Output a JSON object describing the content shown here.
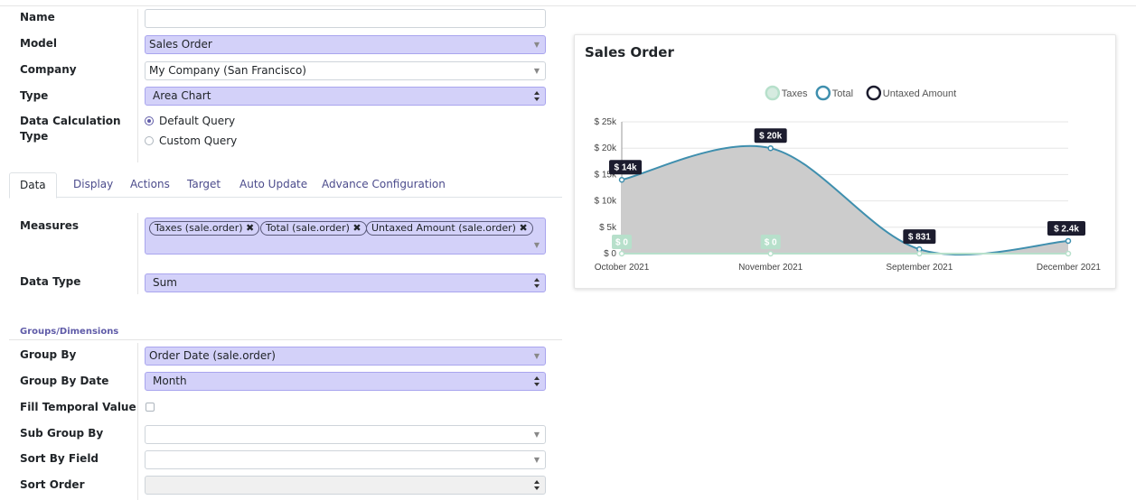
{
  "form": {
    "name": {
      "label": "Name",
      "value": ""
    },
    "model": {
      "label": "Model",
      "value": "Sales Order"
    },
    "company": {
      "label": "Company",
      "value": "My Company (San Francisco)"
    },
    "type": {
      "label": "Type",
      "value": "Area Chart"
    },
    "calc_type": {
      "label_line1": "Data Calculation",
      "label_line2": "Type",
      "options": [
        "Default Query",
        "Custom Query"
      ],
      "selected": "Default Query"
    }
  },
  "tabs": [
    {
      "label": "Data",
      "active": true
    },
    {
      "label": "Display",
      "active": false
    },
    {
      "label": "Actions",
      "active": false
    },
    {
      "label": "Target",
      "active": false
    },
    {
      "label": "Auto Update",
      "active": false
    },
    {
      "label": "Advance Configuration",
      "active": false
    }
  ],
  "data_tab": {
    "measures": {
      "label": "Measures",
      "tags": [
        "Taxes (sale.order)",
        "Total (sale.order)",
        "Untaxed Amount (sale.order)"
      ]
    },
    "data_type": {
      "label": "Data Type",
      "value": "Sum"
    }
  },
  "groups": {
    "section_title": "Groups/Dimensions",
    "group_by": {
      "label": "Group By",
      "value": "Order Date (sale.order)"
    },
    "group_by_date": {
      "label": "Group By Date",
      "value": "Month"
    },
    "fill_temporal": {
      "label": "Fill Temporal Value",
      "checked": false
    },
    "sub_group_by": {
      "label": "Sub Group By",
      "value": ""
    },
    "sort_by_field": {
      "label": "Sort By Field",
      "value": ""
    },
    "sort_order": {
      "label": "Sort Order",
      "value": ""
    }
  },
  "chart_data": {
    "type": "area",
    "title": "Sales Order",
    "categories": [
      "October 2021",
      "November 2021",
      "September 2021",
      "December 2021"
    ],
    "series": [
      {
        "name": "Taxes",
        "values": [
          0,
          0,
          0,
          0
        ],
        "color": "#b7e0cb",
        "labels": [
          "$ 0",
          "$ 0",
          "",
          ""
        ]
      },
      {
        "name": "Total",
        "values": [
          14000,
          20000,
          831,
          2400
        ],
        "color": "#3f8fae",
        "labels": [
          "$ 14k",
          "$ 20k",
          "$ 831",
          "$ 2.4k"
        ]
      },
      {
        "name": "Untaxed Amount",
        "values": [
          14000,
          20000,
          831,
          2400
        ],
        "color": "#1c1c2e",
        "labels": [
          "",
          "",
          "",
          ""
        ]
      }
    ],
    "y_ticks": [
      "$ 0",
      "$ 5k",
      "$ 10k",
      "$ 15k",
      "$ 20k",
      "$ 25k"
    ],
    "ylim": [
      0,
      25000
    ],
    "grid": true,
    "legend": "top-center",
    "area_fill": "#cccccc"
  }
}
